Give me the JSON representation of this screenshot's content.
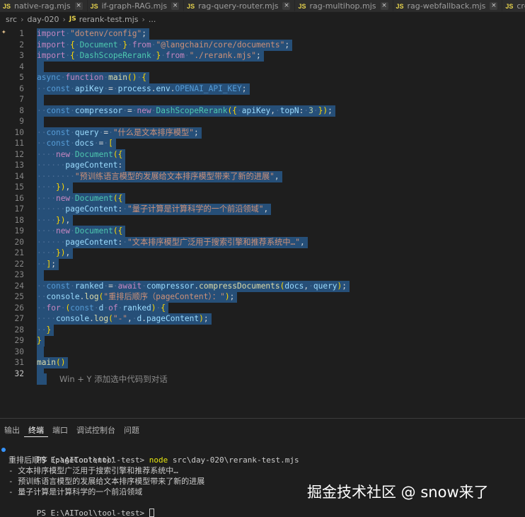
{
  "tabs": [
    {
      "label": "native-rag.mjs"
    },
    {
      "label": "if-graph-RAG.mjs"
    },
    {
      "label": "rag-query-router.mjs"
    },
    {
      "label": "rag-multihop.mjs"
    },
    {
      "label": "rag-webfallback.mjs"
    },
    {
      "label": "create.mjs"
    }
  ],
  "tab_js_badge": "JS",
  "tab_close_glyph": "×",
  "breadcrumb": {
    "items": [
      "src",
      "day-020",
      "rerank-test.mjs",
      "..."
    ],
    "sep": "›"
  },
  "editor": {
    "lines": [
      {
        "n": "1",
        "code": "import \"dotenv/config\";"
      },
      {
        "n": "2",
        "code": "import { Document } from \"@langchain/core/documents\";"
      },
      {
        "n": "3",
        "code": "import { DashScopeRerank } from \"./rerank.mjs\";"
      },
      {
        "n": "4",
        "code": ""
      },
      {
        "n": "5",
        "code": "async function main() {"
      },
      {
        "n": "6",
        "code": "  const apiKey = process.env.OPENAI_API_KEY;"
      },
      {
        "n": "7",
        "code": ""
      },
      {
        "n": "8",
        "code": "  const compressor = new DashScopeRerank({ apiKey, topN: 3 });"
      },
      {
        "n": "9",
        "code": ""
      },
      {
        "n": "10",
        "code": "  const query = \"什么是文本排序模型\";"
      },
      {
        "n": "11",
        "code": "  const docs = ["
      },
      {
        "n": "12",
        "code": "    new Document({"
      },
      {
        "n": "13",
        "code": "      pageContent:"
      },
      {
        "n": "14",
        "code": "        \"预训练语言模型的发展给文本排序模型带来了新的进展\","
      },
      {
        "n": "15",
        "code": "    }),"
      },
      {
        "n": "16",
        "code": "    new Document({"
      },
      {
        "n": "17",
        "code": "      pageContent: \"量子计算是计算科学的一个前沿领域\","
      },
      {
        "n": "18",
        "code": "    }),"
      },
      {
        "n": "19",
        "code": "    new Document({"
      },
      {
        "n": "20",
        "code": "      pageContent: \"文本排序模型广泛用于搜索引擎和推荐系统中…\","
      },
      {
        "n": "21",
        "code": "    }),"
      },
      {
        "n": "22",
        "code": "  ];"
      },
      {
        "n": "23",
        "code": ""
      },
      {
        "n": "24",
        "code": "  const ranked = await compressor.compressDocuments(docs, query);"
      },
      {
        "n": "25",
        "code": "  console.log(\"重排后顺序（pageContent）：\");"
      },
      {
        "n": "26",
        "code": "  for (const d of ranked) {"
      },
      {
        "n": "27",
        "code": "    console.log(\"-\", d.pageContent);"
      },
      {
        "n": "28",
        "code": "  }"
      },
      {
        "n": "29",
        "code": "}"
      },
      {
        "n": "30",
        "code": ""
      },
      {
        "n": "31",
        "code": "main()"
      },
      {
        "n": "32",
        "code": ""
      }
    ],
    "inline_hint": "Win + Y 添加选中代码到对话"
  },
  "panel": {
    "tabs": [
      {
        "label": "输出",
        "active": false
      },
      {
        "label": "终端",
        "active": true
      },
      {
        "label": "端口",
        "active": false
      },
      {
        "label": "调试控制台",
        "active": false
      },
      {
        "label": "问题",
        "active": false
      }
    ],
    "terminal": {
      "prompt_line": {
        "prompt": "PS E:\\AITool\\tool-test> ",
        "cmd": "node",
        "args": " src\\day-020\\rerank-test.mjs"
      },
      "output": [
        "重排后顺序（pageContent）：",
        "- 文本排序模型广泛用于搜索引擎和推荐系统中…",
        "- 预训练语言模型的发展给文本排序模型带来了新的进展",
        "- 量子计算是计算科学的一个前沿领域"
      ],
      "final_prompt": "PS E:\\AITool\\tool-test> "
    }
  },
  "watermark": "掘金技术社区 @ snow来了"
}
